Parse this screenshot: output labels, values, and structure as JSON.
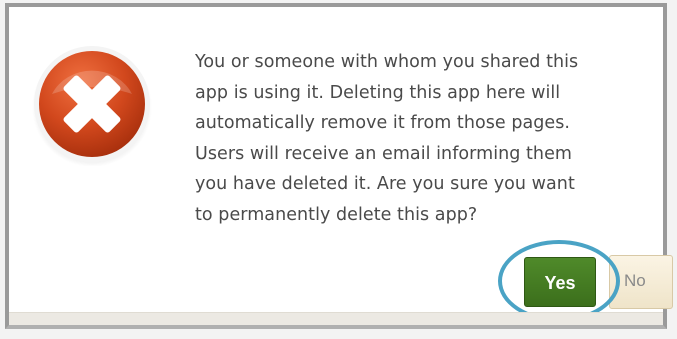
{
  "dialog": {
    "icon": "error-x-icon",
    "message_lines": [
      "You or someone with whom you shared this",
      "app is using it. Deleting this app here will",
      "automatically remove it from those pages.",
      "Users will receive an email informing them",
      "you have deleted it. Are you sure you want",
      "to permanently delete this app?"
    ],
    "yes_label": "Yes",
    "no_label": "No"
  },
  "colors": {
    "icon_red": "#c8401a",
    "yes_button": "#3f7420",
    "highlight_ring": "#4aa3c5",
    "no_button": "#f6ecd6"
  }
}
